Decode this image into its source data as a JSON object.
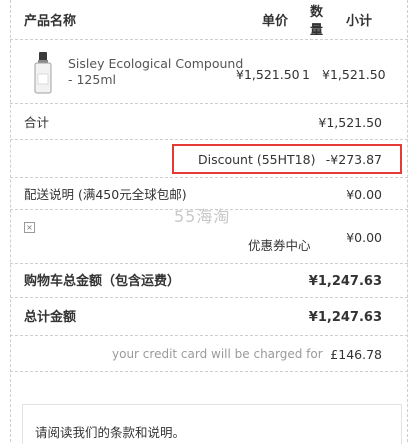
{
  "header": {
    "product_col": "产品名称",
    "price_col": "单价",
    "qty_col_line1": "数",
    "qty_col_line2": "量",
    "subtotal_col": "小计"
  },
  "product": {
    "name_line1": "Sisley Ecological Compound",
    "name_line2": "- 125ml",
    "unit_price": "¥1,521.50",
    "qty": "1",
    "subtotal": "¥1,521.50",
    "icon": "bottle-icon"
  },
  "summary": {
    "total_label": "合计",
    "total_value": "¥1,521.50",
    "discount_label": "Discount (55HT18)",
    "discount_value": "-¥273.87",
    "shipping_label": "配送说明 (满450元全球包邮)",
    "shipping_value": "¥0.00",
    "coupon_label": "优惠券中心",
    "coupon_value": "¥0.00",
    "cart_total_label": "购物车总金额（包含运费）",
    "cart_total_value": "¥1,247.63",
    "grand_total_label": "总计金额",
    "grand_total_value": "¥1,247.63",
    "charged_label": "your credit card will be charged for",
    "charged_value": "£146.78"
  },
  "watermark": "55海淘",
  "notice": "请阅读我们的条款和说明。",
  "colors": {
    "highlight": "#e53935",
    "border": "#cfcfcf"
  }
}
